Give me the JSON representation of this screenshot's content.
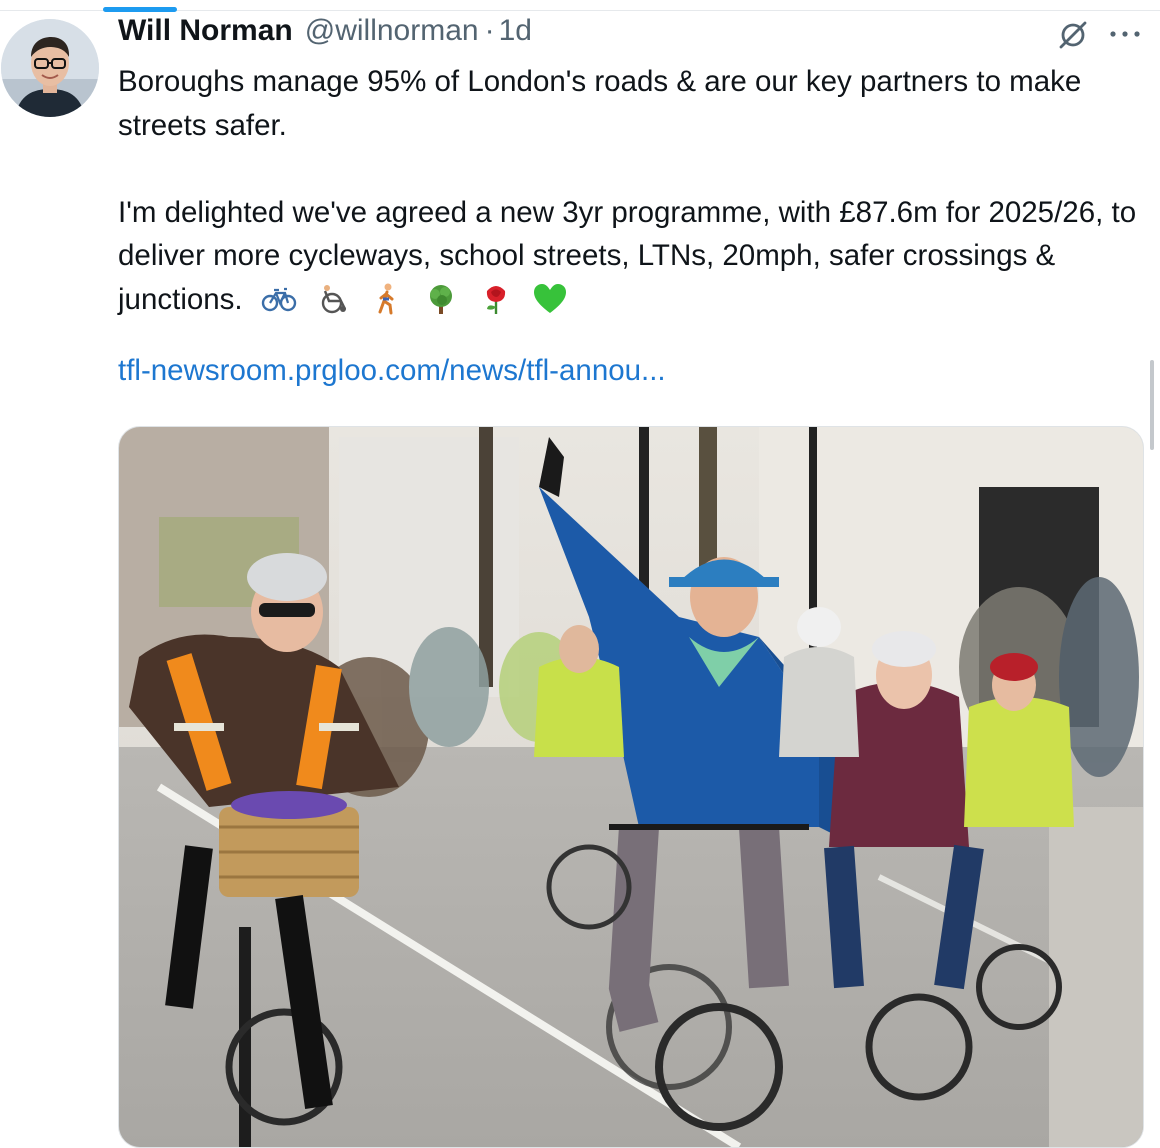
{
  "author": {
    "display_name": "Will Norman",
    "handle": "@willnorman",
    "separator": "·",
    "timestamp": "1d"
  },
  "tweet": {
    "paragraphs": [
      "Boroughs manage 95% of London's roads & are our key partners to make streets safer.",
      "I'm delighted we've agreed a new 3yr programme, with £87.6m for 2025/26, to deliver more cycleways, school streets, LTNs, 20mph, safer crossings & junctions."
    ],
    "emojis": [
      "bicycle-emoji",
      "manual-wheelchair-emoji",
      "person-walking-emoji",
      "tree-emoji",
      "rose-emoji",
      "green-heart-emoji"
    ],
    "link": "tfl-newsroom.prgloo.com/news/tfl-annou..."
  },
  "icons": {
    "grok": "grok-icon",
    "more": "more-icon"
  },
  "colors": {
    "accent_blue": "#1d9bf0",
    "link": "#1d77d0",
    "secondary_text": "#536471"
  }
}
